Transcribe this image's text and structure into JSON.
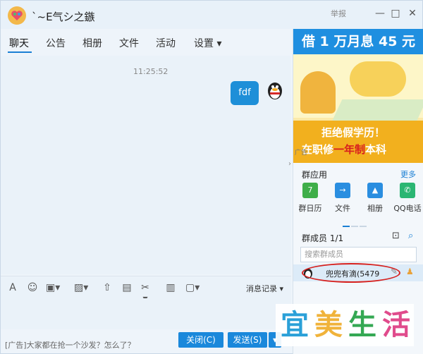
{
  "window": {
    "title": "`~E气シ之鏃",
    "report": "举报",
    "min": "—",
    "max": "□",
    "close": "✕"
  },
  "tabs": [
    {
      "label": "聊天"
    },
    {
      "label": "公告"
    },
    {
      "label": "相册"
    },
    {
      "label": "文件"
    },
    {
      "label": "活动"
    },
    {
      "label": "设置 ▾"
    }
  ],
  "chat": {
    "timestamp": "11:25:52",
    "message": "fdf"
  },
  "toolbar": {
    "message_log": "消息记录 ▾"
  },
  "bottom": {
    "ad_text": "[广告]大家都在抢一个沙发？怎么了？",
    "close_label": "关闭(C)",
    "send_label": "发送(S)",
    "send_arrow": "▾"
  },
  "banner": {
    "top": "借 1 万月息 45 元",
    "line1": "拒绝假学历！",
    "line2a": "在职修",
    "line2b": "一年制",
    "line2c": "本科",
    "ad_tag": "广告"
  },
  "group_apps": {
    "heading": "群应用",
    "more": "更多",
    "items": [
      {
        "label": "群日历",
        "icon": "7",
        "color": "#3fae49"
      },
      {
        "label": "文件",
        "icon": "→",
        "color": "#2a8ee0"
      },
      {
        "label": "相册",
        "icon": "▲",
        "color": "#2a8ee0"
      },
      {
        "label": "QQ电话",
        "icon": "✆",
        "color": "#2bb673"
      }
    ]
  },
  "members": {
    "heading": "群成员  1/1",
    "search_placeholder": "搜索群成员",
    "member_name": "兜兜有滴(5479"
  },
  "watermark": [
    "宜",
    "美",
    "生",
    "活"
  ]
}
